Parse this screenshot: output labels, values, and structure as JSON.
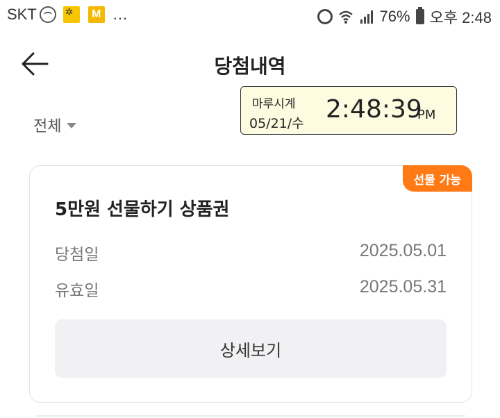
{
  "status_bar": {
    "carrier": "SKT",
    "more": "...",
    "battery": "76%",
    "time": "오후 2:48",
    "icons": [
      "soccer-ball-icon",
      "app-notification-icon",
      "m-app-icon",
      "alarm-icon",
      "wifi-icon",
      "signal-icon",
      "battery-icon"
    ]
  },
  "header": {
    "title": "당첨내역",
    "back_icon": "arrow-left-icon"
  },
  "clock_overlay": {
    "name": "마루시계",
    "date": "05/21/수",
    "time": "2:48:39",
    "ampm": "PM"
  },
  "filter": {
    "label": "전체",
    "icon": "caret-down-icon"
  },
  "card": {
    "badge": "선물 가능",
    "title": "5만원 선물하기 상품권",
    "rows": [
      {
        "label": "당첨일",
        "value": "2025.05.01"
      },
      {
        "label": "유효일",
        "value": "2025.05.31"
      }
    ],
    "detail_button": "상세보기"
  },
  "colors": {
    "badge": "#ff7a14",
    "button_bg": "#f1f1f3",
    "clock_bg": "#fdfbe0"
  }
}
